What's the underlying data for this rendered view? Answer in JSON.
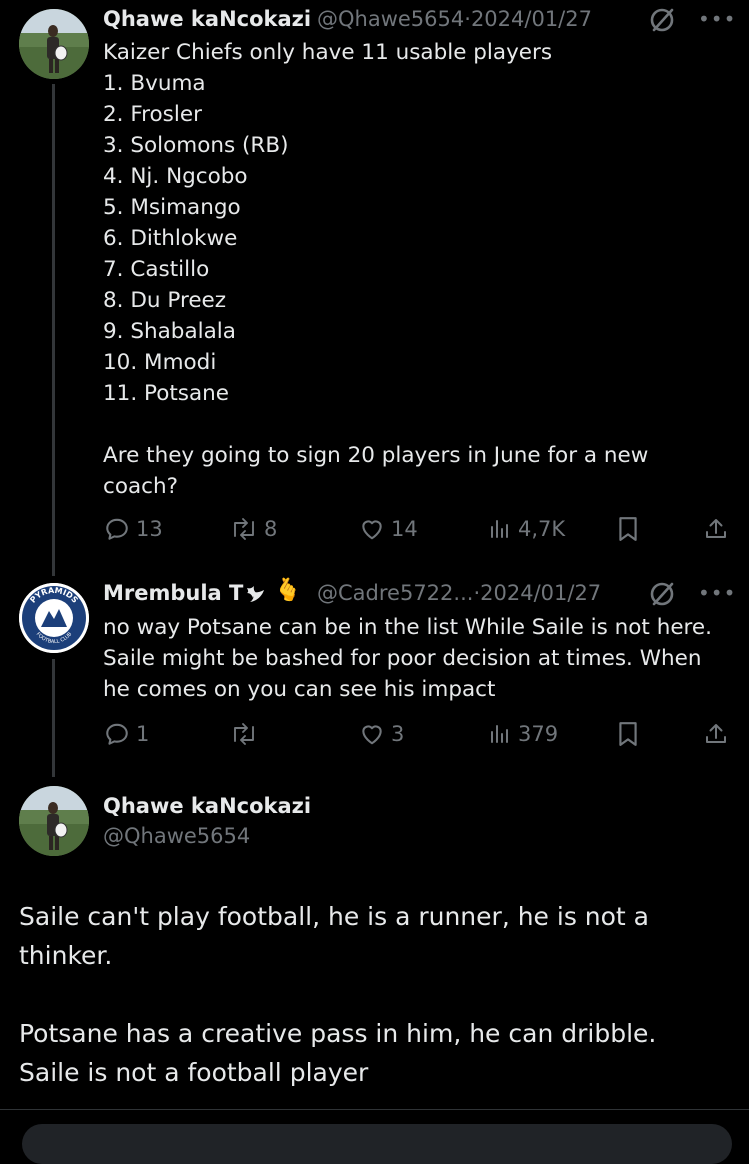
{
  "tweets": [
    {
      "name": "Qhawe kaNcokazi",
      "handle": "@Qhawe5654",
      "sep": "·",
      "date": "2024/01/27",
      "text": "Kaizer Chiefs only have 11 usable players\n1. Bvuma\n2. Frosler\n3. Solomons (RB)\n4. Nj. Ngcobo\n5. Msimango\n6. Dithlokwe\n7. Castillo\n8. Du Preez\n9. Shabalala\n10. Mmodi\n11. Potsane\n\nAre they going to sign 20 players in June for a new coach?",
      "replies": "13",
      "retweets": "8",
      "likes": "14",
      "views": "4,7K"
    },
    {
      "name": "Mrembula T",
      "emoji": "🫰",
      "handle": "@Cadre5722...",
      "sep": "·",
      "date": "2024/01/27",
      "text": "no way Potsane can be in the list While Saile is not here. Saile might be bashed for poor decision at times. When he comes on you can see his impact",
      "replies": "1",
      "retweets": "",
      "likes": "3",
      "views": "379",
      "avatar_text": "PYRAMIDS",
      "avatar_subtext": "FOOTBALL CLUB"
    }
  ],
  "main_tweet": {
    "name": "Qhawe kaNcokazi",
    "handle": "@Qhawe5654",
    "text": "Saile can't play football, he is a runner, he is not a thinker.\n\nPotsane has a creative pass in him, he can dribble. Saile is not a football player"
  },
  "icons": {
    "grok": "grok-icon",
    "more": "more-icon",
    "reply": "reply-icon",
    "retweet": "retweet-icon",
    "like": "heart-icon",
    "views": "views-icon",
    "bookmark": "bookmark-icon",
    "share": "share-icon"
  },
  "colors": {
    "background": "#000000",
    "text": "#e7e9ea",
    "muted": "#71767b",
    "line": "#333639"
  }
}
